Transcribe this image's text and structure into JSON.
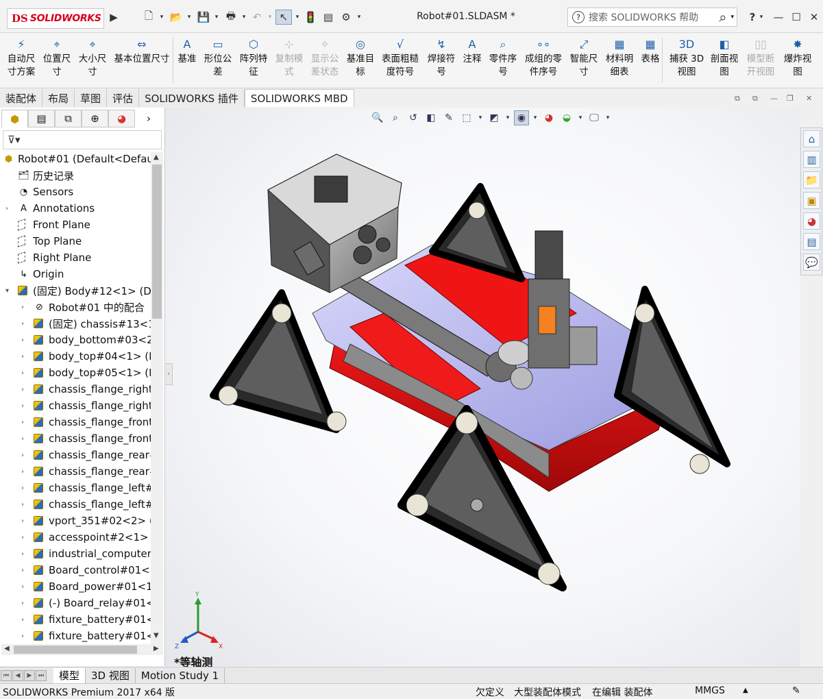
{
  "app": {
    "logo_prefix": "DS",
    "logo_text": "SOLIDWORKS",
    "document_title": "Robot#01.SLDASM *",
    "search_placeholder": "搜索 SOLIDWORKS 帮助",
    "help_label": "?",
    "colors": {
      "brand": "#d6001c",
      "accent": "#1f5fa8",
      "body_red": "#e01010",
      "body_lavender": "#b9b9f0"
    }
  },
  "ribbon": {
    "buttons": [
      {
        "label": "自动尺寸方案",
        "icon": "auto-dimension-icon",
        "disabled": false
      },
      {
        "label": "位置尺寸",
        "icon": "location-dimension-icon",
        "disabled": false
      },
      {
        "label": "大小尺寸",
        "icon": "size-dimension-icon",
        "disabled": false
      },
      {
        "label": "基本位置尺寸",
        "icon": "basic-location-dimension-icon",
        "disabled": false
      },
      {
        "label": "基准",
        "icon": "datum-icon",
        "disabled": false
      },
      {
        "label": "形位公差",
        "icon": "geometric-tolerance-icon",
        "disabled": false
      },
      {
        "label": "阵列特征",
        "icon": "pattern-feature-icon",
        "disabled": false
      },
      {
        "label": "复制模式",
        "icon": "copy-scheme-icon",
        "disabled": true
      },
      {
        "label": "显示公差状态",
        "icon": "show-tolerance-status-icon",
        "disabled": true
      },
      {
        "label": "基准目标",
        "icon": "datum-target-icon",
        "disabled": false
      },
      {
        "label": "表面粗糙度符号",
        "icon": "surface-finish-icon",
        "disabled": false
      },
      {
        "label": "焊接符号",
        "icon": "weld-symbol-icon",
        "disabled": false
      },
      {
        "label": "注释",
        "icon": "note-icon",
        "disabled": false
      },
      {
        "label": "零件序号",
        "icon": "balloon-icon",
        "disabled": false
      },
      {
        "label": "成组的零件序号",
        "icon": "stacked-balloon-icon",
        "disabled": false
      },
      {
        "label": "智能尺寸",
        "icon": "smart-dimension-icon",
        "disabled": false
      },
      {
        "label": "材料明细表",
        "icon": "bom-icon",
        "disabled": false
      },
      {
        "label": "表格",
        "icon": "table-icon",
        "disabled": false
      },
      {
        "label": "捕获 3D 视图",
        "icon": "capture-3d-view-icon",
        "disabled": false
      },
      {
        "label": "剖面视图",
        "icon": "section-view-icon",
        "disabled": false
      },
      {
        "label": "模型断开视图",
        "icon": "model-break-view-icon",
        "disabled": true
      },
      {
        "label": "爆炸视图",
        "icon": "exploded-view-icon",
        "disabled": false
      }
    ]
  },
  "tabs": [
    "装配体",
    "布局",
    "草图",
    "评估",
    "SOLIDWORKS 插件",
    "SOLIDWORKS MBD"
  ],
  "active_tab": "SOLIDWORKS MBD",
  "tree": {
    "root": "Robot#01  (Default<Default",
    "items": [
      {
        "label": "历史记录",
        "icon": "history-icon",
        "level": 1,
        "expand": false
      },
      {
        "label": "Sensors",
        "icon": "sensor-icon",
        "level": 1,
        "expand": false
      },
      {
        "label": "Annotations",
        "icon": "annotations-icon",
        "level": 1,
        "expand": true
      },
      {
        "label": "Front Plane",
        "icon": "plane-icon",
        "level": 1,
        "expand": false
      },
      {
        "label": "Top Plane",
        "icon": "plane-icon",
        "level": 1,
        "expand": false
      },
      {
        "label": "Right Plane",
        "icon": "plane-icon",
        "level": 1,
        "expand": false
      },
      {
        "label": "Origin",
        "icon": "origin-icon",
        "level": 1,
        "expand": false
      },
      {
        "label": "(固定) Body#12<1> (Defa",
        "icon": "subassembly-icon",
        "level": 1,
        "expand": true,
        "open": true
      },
      {
        "label": "Robot#01 中的配合",
        "icon": "mates-icon",
        "level": 2,
        "expand": true
      },
      {
        "label": "(固定) chassis#13<1>",
        "icon": "part-icon",
        "level": 2,
        "expand": true
      },
      {
        "label": "body_bottom#03<2>",
        "icon": "part-icon",
        "level": 2,
        "expand": true
      },
      {
        "label": "body_top#04<1> (D",
        "icon": "part-icon",
        "level": 2,
        "expand": true
      },
      {
        "label": "body_top#05<1> (D",
        "icon": "part-icon",
        "level": 2,
        "expand": true
      },
      {
        "label": "chassis_flange_right",
        "icon": "part-icon",
        "level": 2,
        "expand": true
      },
      {
        "label": "chassis_flange_right",
        "icon": "part-icon",
        "level": 2,
        "expand": true
      },
      {
        "label": "chassis_flange_front",
        "icon": "part-icon",
        "level": 2,
        "expand": true
      },
      {
        "label": "chassis_flange_front",
        "icon": "part-icon",
        "level": 2,
        "expand": true
      },
      {
        "label": "chassis_flange_rear#",
        "icon": "part-icon",
        "level": 2,
        "expand": true
      },
      {
        "label": "chassis_flange_rear#",
        "icon": "part-icon",
        "level": 2,
        "expand": true
      },
      {
        "label": "chassis_flange_left#(",
        "icon": "part-icon",
        "level": 2,
        "expand": true
      },
      {
        "label": "chassis_flange_left#(",
        "icon": "part-icon",
        "level": 2,
        "expand": true
      },
      {
        "label": "vport_351#02<2> (D",
        "icon": "part-icon",
        "level": 2,
        "expand": true
      },
      {
        "label": "accesspoint#2<1> (",
        "icon": "part-icon",
        "level": 2,
        "expand": true
      },
      {
        "label": "industrial_computer",
        "icon": "part-icon",
        "level": 2,
        "expand": true
      },
      {
        "label": "Board_control#01<1",
        "icon": "part-icon",
        "level": 2,
        "expand": true
      },
      {
        "label": "Board_power#01<1",
        "icon": "part-icon",
        "level": 2,
        "expand": true
      },
      {
        "label": "(-) Board_relay#01<1",
        "icon": "part-icon",
        "level": 2,
        "expand": true
      },
      {
        "label": "fixture_battery#01<",
        "icon": "part-icon",
        "level": 2,
        "expand": true
      },
      {
        "label": "fixture_battery#01<",
        "icon": "part-icon",
        "level": 2,
        "expand": true
      }
    ]
  },
  "viewport": {
    "view_label": "*等轴测",
    "triad": {
      "x": "X",
      "y": "Y",
      "z": "Z"
    }
  },
  "bottom_tabs": [
    "模型",
    "3D 视图",
    "Motion Study 1"
  ],
  "active_bottom_tab": "模型",
  "status": {
    "product": "SOLIDWORKS Premium 2017 x64 版",
    "under_defined": "欠定义",
    "large_assembly": "大型装配体模式",
    "editing": "在编辑 装配体",
    "units": "MMGS",
    "units_arrow": "▲"
  }
}
